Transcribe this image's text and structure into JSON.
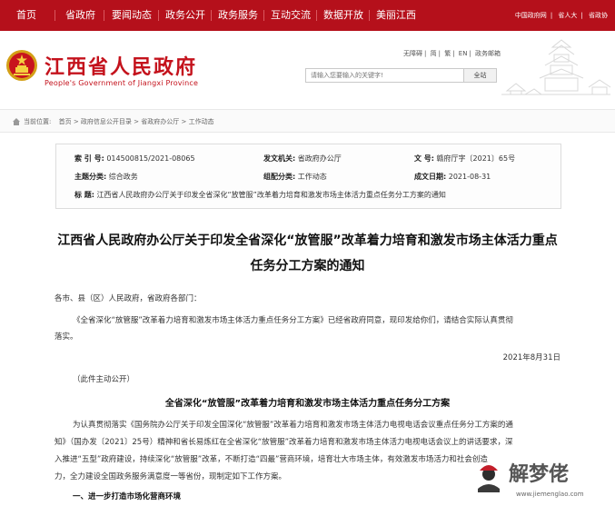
{
  "nav": {
    "items": [
      "首页",
      "省政府",
      "要闻动态",
      "政务公开",
      "政务服务",
      "互动交流",
      "数据开放",
      "美丽江西"
    ],
    "top_links": [
      "中国政府网",
      "省人大",
      "省政协"
    ]
  },
  "header": {
    "title_cn": "江西省人民政府",
    "title_en": "People's Government of Jiangxi Province",
    "util": [
      "无障碍",
      "简",
      "繁",
      "EN",
      "政务邮箱"
    ],
    "search_placeholder": "请输入您要输入的关键字!",
    "search_button": "全站"
  },
  "breadcrumb": {
    "items": [
      "当前位置:",
      "首页",
      "政府信息公开目录",
      "省政府办公厅",
      "工作动态"
    ]
  },
  "meta": {
    "index_label": "索 引 号:",
    "index_value": "014500815/2021-08065",
    "issuer_label": "发文机关:",
    "issuer_value": "省政府办公厅",
    "docno_label": "文 号:",
    "docno_value": "赣府厅字〔2021〕65号",
    "topic_label": "主题分类:",
    "topic_value": "综合政务",
    "category_label": "组配分类:",
    "category_value": "工作动态",
    "date_label": "成文日期:",
    "date_value": "2021-08-31",
    "title_label": "标 题:",
    "title_value": "江西省人民政府办公厅关于印发全省深化“放管服”改革着力培育和激发市场主体活力重点任务分工方案的通知"
  },
  "article": {
    "title_line1": "江西省人民政府办公厅关于印发全省深化“放管服”改革着力培育和激发市场主体活力重点",
    "title_line2": "任务分工方案的通知",
    "greeting": "各市、县（区）人民政府，省政府各部门：",
    "para1_line1": "《全省深化“放管服”改革着力培育和激发市场主体活力重点任务分工方案》已经省政府同意，现印发给你们，请结合实际认真贯彻",
    "para1_line2": "落实。",
    "date": "2021年8月31日",
    "public_note": "（此件主动公开）",
    "sub_title": "全省深化“放管服”改革着力培育和激发市场主体活力重点任务分工方案",
    "para2_line1": "为认真贯彻落实《国务院办公厅关于印发全国深化“放管服”改革着力培育和激发市场主体活力电视电话会议重点任务分工方案的通",
    "para2_line2": "知》（国办发〔2021〕25号）精神和省长易炼红在全省深化“放管服”改革着力培育和激发市场主体活力电视电话会议上的讲话要求，深",
    "para2_line3": "入推进“五型”政府建设，持续深化“放管服”改革，不断打造“四最”营商环境，培育壮大市场主体，有效激发市场活力和社会创造",
    "para2_line4": "力，全力建设全国政务服务满意度一等省份，现制定如下工作方案。",
    "section1": "一、进一步打造市场化营商环境"
  },
  "watermark": {
    "text": "解梦佬",
    "url": "www.jiemenglao.com"
  }
}
